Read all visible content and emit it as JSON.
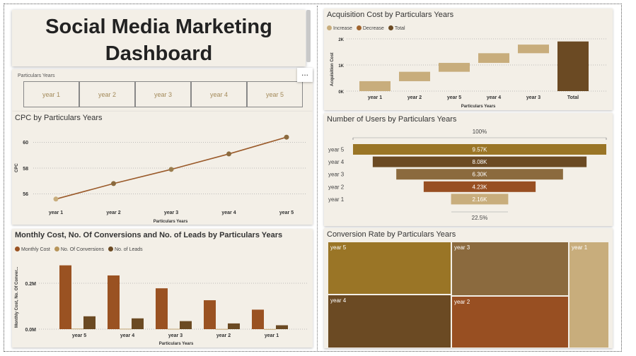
{
  "title": "Social Media Marketing\nDashboard",
  "slicer": {
    "label": "Particulars Years",
    "items": [
      "year 1",
      "year 2",
      "year 3",
      "year 4",
      "year 5"
    ]
  },
  "more_icon": "...",
  "colors": {
    "increase": "#c8ad7c",
    "decrease": "#a0642e",
    "total": "#6b4a23",
    "line": "#9a5a2a",
    "bar_cost": "#9a5222",
    "bar_conv": "#b7955a",
    "bar_leads": "#6b4a23"
  },
  "charts": {
    "waterfall": {
      "title": "Acquisition Cost by Particulars Years",
      "legend": [
        "Increase",
        "Decrease",
        "Total"
      ],
      "ylabel": "Acquisition Cost",
      "xlabel": "Particulars Years",
      "yticks": [
        "2K",
        "1K",
        "0K"
      ]
    },
    "cpc": {
      "title": "CPC by Particulars Years",
      "ylabel": "CPC",
      "xlabel": "Particulars Years",
      "yticks": [
        "60",
        "58",
        "56"
      ]
    },
    "funnel": {
      "title": "Number of Users by Particulars Years",
      "top_pct": "100%",
      "bottom_pct": "22.5%"
    },
    "combo": {
      "title": "Monthly Cost, No. Of Conversions and No. of Leads by Particulars Years",
      "legend": [
        "Monthly Cost",
        "No. Of Conversions",
        "No. of Leads"
      ],
      "ylabel": "Monthly Cost, No. Of Conver...",
      "xlabel": "Particulars Years",
      "yticks": [
        "0.2M",
        "0.0M"
      ]
    },
    "treemap": {
      "title": "Conversion Rate by Particulars Years"
    }
  },
  "chart_data": [
    {
      "type": "bar",
      "title": "Acquisition Cost by Particulars Years",
      "subtype": "waterfall",
      "categories": [
        "year 1",
        "year 2",
        "year 5",
        "year 4",
        "year 3",
        "Total"
      ],
      "steps": [
        {
          "start": 0,
          "end": 380
        },
        {
          "start": 380,
          "end": 740
        },
        {
          "start": 740,
          "end": 1080
        },
        {
          "start": 1080,
          "end": 1450
        },
        {
          "start": 1450,
          "end": 1780
        }
      ],
      "total": 1900,
      "ylim": [
        0,
        2000
      ],
      "ylabel": "Acquisition Cost",
      "xlabel": "Particulars Years"
    },
    {
      "type": "line",
      "title": "CPC by Particulars Years",
      "categories": [
        "year 1",
        "year 2",
        "year 3",
        "year 4",
        "year 5"
      ],
      "values": [
        55.6,
        56.8,
        57.9,
        59.1,
        60.4
      ],
      "ylim": [
        55,
        61
      ],
      "ylabel": "CPC",
      "xlabel": "Particulars Years"
    },
    {
      "type": "bar",
      "subtype": "funnel",
      "title": "Number of Users by Particulars Years",
      "categories": [
        "year 5",
        "year 4",
        "year 3",
        "year 2",
        "year 1"
      ],
      "values": [
        9570,
        8080,
        6300,
        4230,
        2160
      ],
      "labels": [
        "9.57K",
        "8.08K",
        "6.30K",
        "4.23K",
        "2.16K"
      ]
    },
    {
      "type": "bar",
      "title": "Monthly Cost, No. Of Conversions and No. of Leads by Particulars Years",
      "categories": [
        "year 5",
        "year 4",
        "year 3",
        "year 2",
        "year 1"
      ],
      "series": [
        {
          "name": "Monthly Cost",
          "values": [
            278000,
            234000,
            178000,
            126000,
            85000
          ]
        },
        {
          "name": "No. Of Conversions",
          "values": [
            2000,
            1500,
            1200,
            800,
            500
          ]
        },
        {
          "name": "No. of Leads",
          "values": [
            56000,
            47000,
            35000,
            25000,
            17000
          ]
        }
      ],
      "ylim": [
        0,
        300000
      ],
      "ylabel": "Monthly Cost, No. Of Conver...",
      "xlabel": "Particulars Years"
    },
    {
      "type": "heatmap",
      "subtype": "treemap",
      "title": "Conversion Rate by Particulars Years",
      "categories": [
        "year 5",
        "year 4",
        "year 3",
        "year 2",
        "year 1"
      ]
    }
  ]
}
